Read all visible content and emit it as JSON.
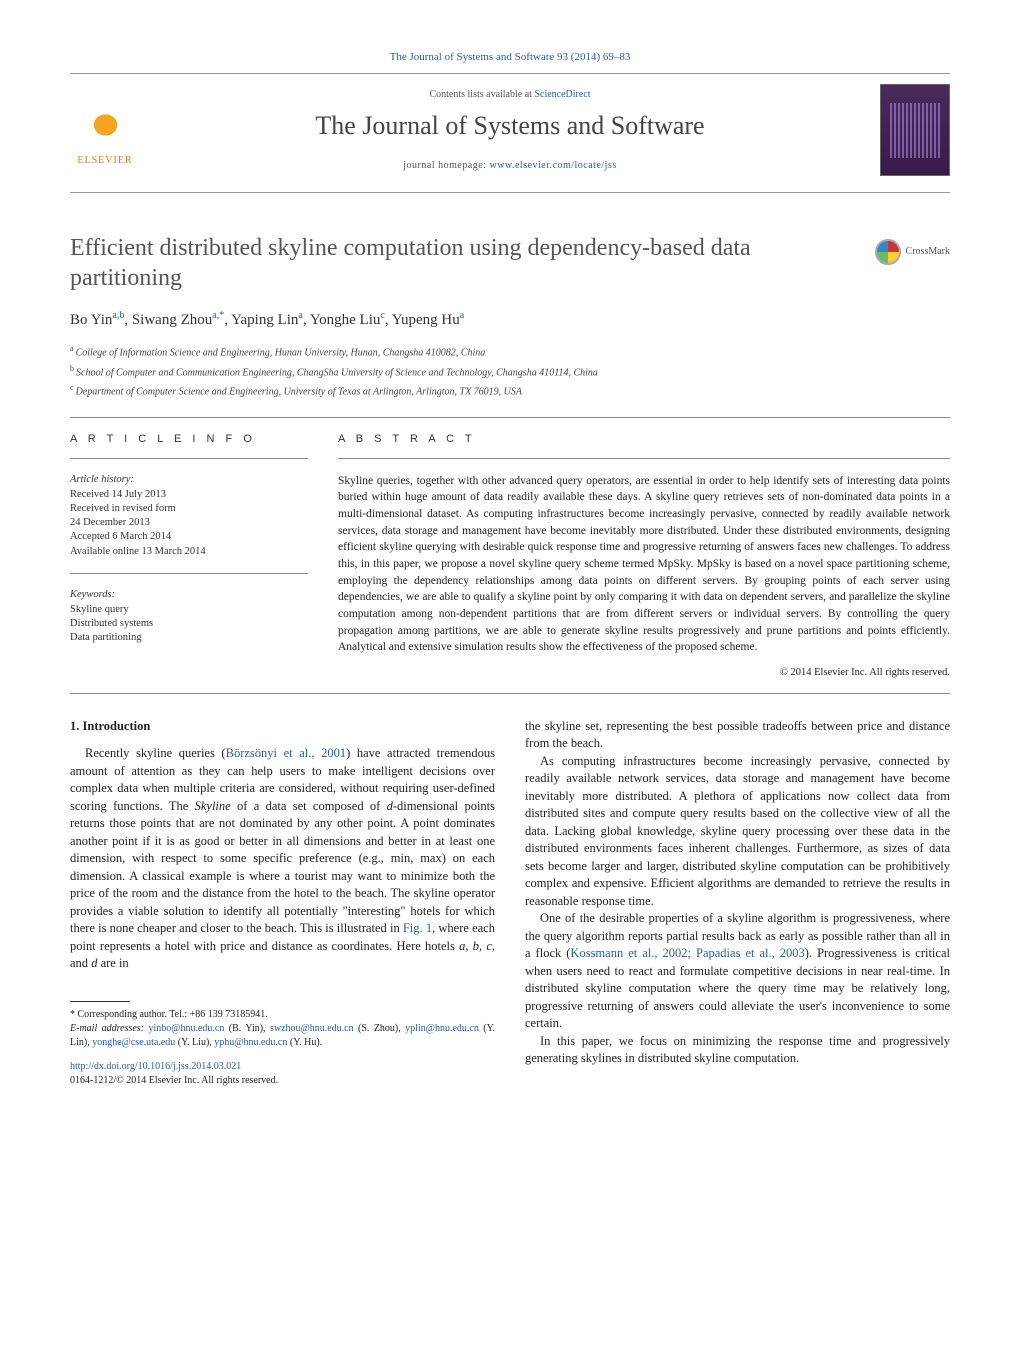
{
  "journal_ref": "The Journal of Systems and Software 93 (2014) 69–83",
  "header": {
    "elsevier": "ELSEVIER",
    "contents_prefix": "Contents lists available at ",
    "contents_link": "ScienceDirect",
    "journal_title": "The Journal of Systems and Software",
    "homepage_prefix": "journal homepage: ",
    "homepage_url": "www.elsevier.com/locate/jss"
  },
  "crossmark": "CrossMark",
  "title": "Efficient distributed skyline computation using dependency-based data partitioning",
  "authors_html": "Bo Yin<sup>a,b</sup>, Siwang Zhou<sup>a,*</sup>, Yaping Lin<sup>a</sup>, Yonghe Liu<sup>c</sup>, Yupeng Hu<sup>a</sup>",
  "authors": [
    {
      "name": "Bo Yin",
      "aff": "a,b"
    },
    {
      "name": "Siwang Zhou",
      "aff": "a,*"
    },
    {
      "name": "Yaping Lin",
      "aff": "a"
    },
    {
      "name": "Yonghe Liu",
      "aff": "c"
    },
    {
      "name": "Yupeng Hu",
      "aff": "a"
    }
  ],
  "affiliations": {
    "a": "College of Information Science and Engineering, Hunan University, Hunan, Changsha 410082, China",
    "b": "School of Computer and Communication Engineering, ChangSha University of Science and Technology, Changsha 410114, China",
    "c": "Department of Computer Science and Engineering, University of Texas at Arlington, Arlington, TX 76019, USA"
  },
  "info": {
    "label": "A R T I C L E   I N F O",
    "history_hd": "Article history:",
    "history": [
      "Received 14 July 2013",
      "Received in revised form",
      "24 December 2013",
      "Accepted 6 March 2014",
      "Available online 13 March 2014"
    ],
    "keywords_hd": "Keywords:",
    "keywords": [
      "Skyline query",
      "Distributed systems",
      "Data partitioning"
    ]
  },
  "abstract": {
    "label": "A B S T R A C T",
    "text": "Skyline queries, together with other advanced query operators, are essential in order to help identify sets of interesting data points buried within huge amount of data readily available these days. A skyline query retrieves sets of non-dominated data points in a multi-dimensional dataset. As computing infrastructures become increasingly pervasive, connected by readily available network services, data storage and management have become inevitably more distributed. Under these distributed environments, designing efficient skyline querying with desirable quick response time and progressive returning of answers faces new challenges. To address this, in this paper, we propose a novel skyline query scheme termed MpSky. MpSky is based on a novel space partitioning scheme, employing the dependency relationships among data points on different servers. By grouping points of each server using dependencies, we are able to qualify a skyline point by only comparing it with data on dependent servers, and parallelize the skyline computation among non-dependent partitions that are from different servers or individual servers. By controlling the query propagation among partitions, we are able to generate skyline results progressively and prune partitions and points efficiently. Analytical and extensive simulation results show the effectiveness of the proposed scheme.",
    "copyright": "© 2014 Elsevier Inc. All rights reserved."
  },
  "body": {
    "sec1_head": "1.  Introduction",
    "p1": "Recently skyline queries (Börzsönyi et al., 2001) have attracted tremendous amount of attention as they can help users to make intelligent decisions over complex data when multiple criteria are considered, without requiring user-defined scoring functions. The Skyline of a data set composed of d-dimensional points returns those points that are not dominated by any other point. A point dominates another point if it is as good or better in all dimensions and better in at least one dimension, with respect to some specific preference (e.g., min, max) on each dimension. A classical example is where a tourist may want to minimize both the price of the room and the distance from the hotel to the beach. The skyline operator provides a viable solution to identify all potentially \"interesting\" hotels for which there is none cheaper and closer to the beach. This is illustrated in Fig. 1, where each point represents a hotel with price and distance as coordinates. Here hotels a, b, c, and d are in",
    "p2": "the skyline set, representing the best possible tradeoffs between price and distance from the beach.",
    "p3": "As computing infrastructures become increasingly pervasive, connected by readily available network services, data storage and management have become inevitably more distributed. A plethora of applications now collect data from distributed sites and compute query results based on the collective view of all the data. Lacking global knowledge, skyline query processing over these data in the distributed environments faces inherent challenges. Furthermore, as sizes of data sets become larger and larger, distributed skyline computation can be prohibitively complex and expensive. Efficient algorithms are demanded to retrieve the results in reasonable response time.",
    "p4": "One of the desirable properties of a skyline algorithm is progressiveness, where the query algorithm reports partial results back as early as possible rather than all in a flock (Kossmann et al., 2002; Papadias et al., 2003). Progressiveness is critical when users need to react and formulate competitive decisions in near real-time. In distributed skyline computation where the query time may be relatively long, progressive returning of answers could alleviate the user's inconvenience to some certain.",
    "p5": "In this paper, we focus on minimizing the response time and progressively generating skylines in distributed skyline computation."
  },
  "footnotes": {
    "corr": "* Corresponding author. Tel.: +86 139 73185941.",
    "emails_label": "E-mail addresses:",
    "emails": "yinbo@hnu.edu.cn (B. Yin), swzhou@hnu.edu.cn (S. Zhou), yplin@hnu.edu.cn (Y. Lin), yonghe@cse.uta.edu (Y. Liu), yphu@hnu.edu.cn (Y. Hu).",
    "doi": "http://dx.doi.org/10.1016/j.jss.2014.03.021",
    "copyright": "0164-1212/© 2014 Elsevier Inc. All rights reserved."
  }
}
